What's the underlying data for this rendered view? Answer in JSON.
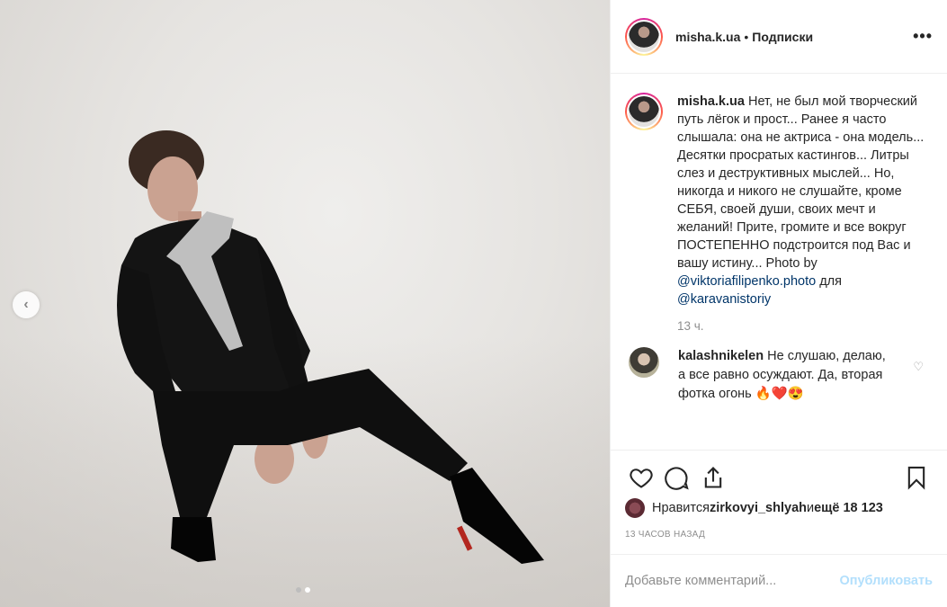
{
  "header": {
    "username": "misha.k.ua",
    "separator": "•",
    "follow_label": "Подписки",
    "more_label": "•••"
  },
  "photo": {
    "carousel_prev": "‹",
    "slides": 2,
    "active_slide": 2
  },
  "caption": {
    "username": "misha.k.ua",
    "lines_before_mention": " Нет, не был мой творческий путь лёгок и прост... Ранее я часто слышала: она не актриса - она модель... Десятки просратых кастингов... Литры слез и деструктивных мыслей... Но, никогда и никого не слушайте, кроме СЕБЯ, своей души, своих мечт и желаний! Прите, громите и все вокруг ПОСТЕПЕННО подстроится под Вас и вашу истину... Photo by ",
    "mention_1": "@viktoriafilipenko.photo",
    "between_mentions": " для ",
    "mention_2": "@karavanistoriy",
    "time": "13 ч."
  },
  "comment": {
    "username": "kalashnikelen",
    "text": " Не слушаю, делаю, а все равно осуждают. Да, вторая фотка огонь 🔥❤️😍",
    "like_icon": "♡"
  },
  "likes": {
    "prefix": "Нравится ",
    "user": "zirkovyi_shlyah",
    "middle": " и ",
    "count_text": "ещё 18 123"
  },
  "post_time": "13 часов назад",
  "add_comment": {
    "placeholder": "Добавьте комментарий...",
    "publish_label": "Опубликовать"
  },
  "colors": {
    "link": "#003569",
    "muted": "#8e8e8e",
    "publish_disabled": "#b2dffc"
  }
}
